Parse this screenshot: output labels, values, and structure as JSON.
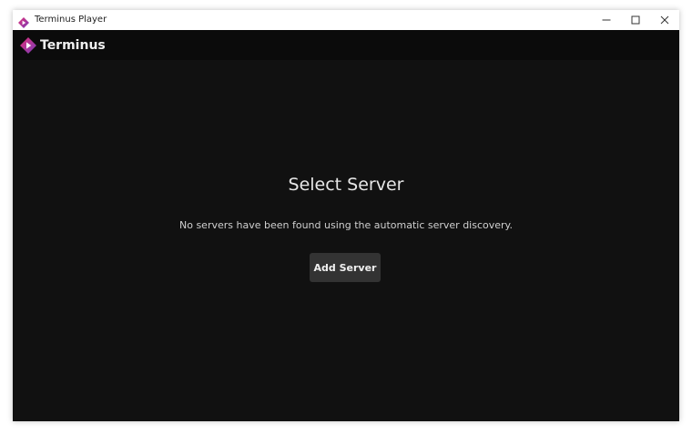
{
  "window": {
    "title": "Terminus Player",
    "controls": {
      "minimize": "minimize-icon",
      "maximize": "maximize-icon",
      "close": "close-icon"
    }
  },
  "appbar": {
    "brand": "Terminus",
    "logo": "terminus-logo-icon"
  },
  "main": {
    "heading": "Select Server",
    "message": "No servers have been found using the automatic server discovery.",
    "add_server_label": "Add Server"
  },
  "colors": {
    "background": "#111111",
    "appbar": "#0b0b0b",
    "button": "#333333",
    "brand_pink": "#e0307a",
    "brand_purple": "#7a3bb8"
  }
}
